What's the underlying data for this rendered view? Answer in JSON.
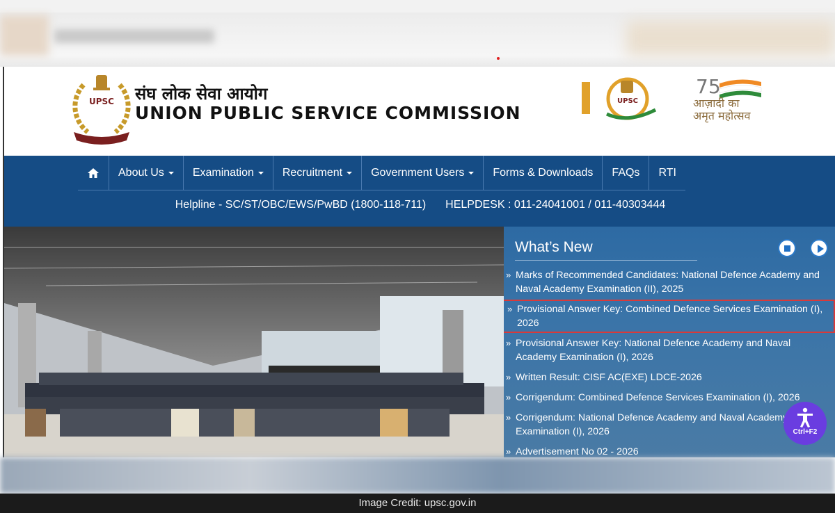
{
  "header": {
    "hindi_name": "संघ लोक सेवा आयोग",
    "english_name": "UNION PUBLIC SERVICE COMMISSION",
    "emblem_label": "UPSC",
    "centenary_label": "UPSC",
    "amrit_line1": "आज़ादी का",
    "amrit_line2": "अमृत महोत्सव"
  },
  "nav": {
    "home_icon": "home-icon",
    "items": [
      {
        "label": "About Us",
        "dropdown": true
      },
      {
        "label": "Examination",
        "dropdown": true
      },
      {
        "label": "Recruitment",
        "dropdown": true
      },
      {
        "label": "Government Users",
        "dropdown": true
      },
      {
        "label": "Forms & Downloads",
        "dropdown": false
      },
      {
        "label": "FAQs",
        "dropdown": false
      },
      {
        "label": "RTI",
        "dropdown": false
      }
    ],
    "helpline": "Helpline - SC/ST/OBC/EWS/PwBD (1800-118-711)",
    "helpdesk": "HELPDESK : 011-24041001 / 011-40303444"
  },
  "whats_new": {
    "title": "What’s New",
    "items": [
      "Marks of Recommended Candidates: National Defence Academy and Naval Academy Examination (II), 2025",
      "Provisional Answer Key: Combined Defence Services Examination (I), 2026",
      "Provisional Answer Key: National Defence Academy and Naval Academy Examination (I), 2026",
      "Written Result: CISF AC(EXE) LDCE-2026",
      "Corrigendum: Combined Defence Services Examination (I), 2026",
      "Corrigendum: National Defence Academy and Naval Academy Examination (I), 2026",
      "Advertisement No 02 - 2026"
    ],
    "highlighted_index": 1
  },
  "accessibility": {
    "label": "Ctrl+F2"
  },
  "credit": "Image Credit: upsc.gov.in",
  "colors": {
    "nav_bg": "#154c85",
    "highlight": "#d93a3a",
    "access_btn": "#6a3de0"
  }
}
